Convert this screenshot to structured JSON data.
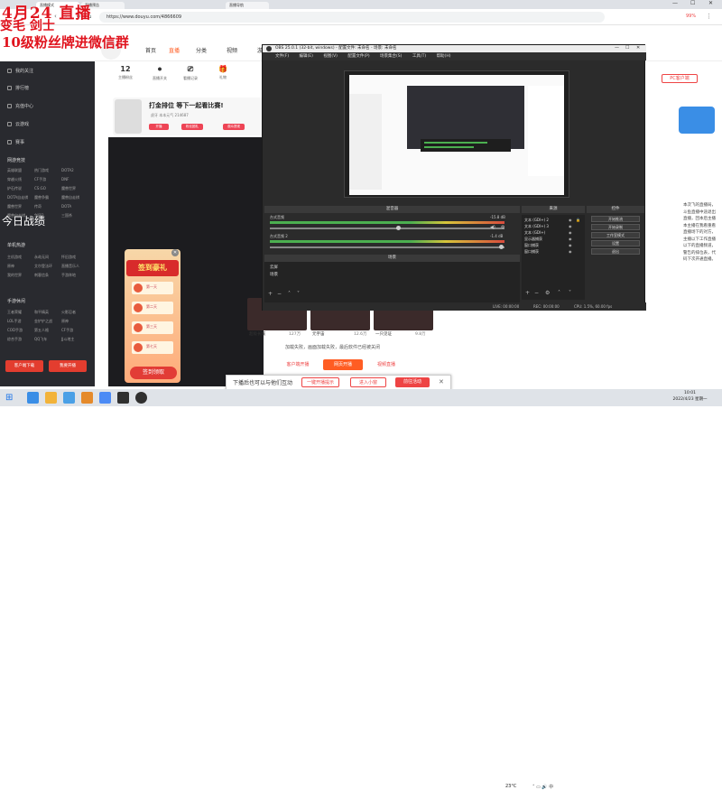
{
  "overlay": {
    "line1": "4月24 直播",
    "line2": "变毛 剑士",
    "line3": "10级粉丝牌进微信群",
    "line4": "今日战绩"
  },
  "browser": {
    "tabs": [
      {
        "label": "直播模式"
      },
      {
        "label": "直播预告"
      },
      {
        "label": "直播导航"
      }
    ],
    "url": "https://www.douyu.com/4866609",
    "profile_pct": "99%"
  },
  "sidebar": {
    "items": [
      {
        "label": "我的关注"
      },
      {
        "label": "排行榜"
      },
      {
        "label": "充值中心"
      },
      {
        "label": "云游戏"
      },
      {
        "label": "赛事"
      }
    ],
    "section1": "网游竞技",
    "grid1": [
      "英雄联盟",
      "热门游戏",
      "DOTA2",
      "穿越火线",
      "CF手游",
      "DNF",
      "炉石传说",
      "CS:GO",
      "魔兽世界",
      "DOTA自走棋",
      "魔兽争霸",
      "魔兽自走棋",
      "魔兽世界",
      "传奇",
      "DOTA",
      "魔兽自走棋",
      "剑网3",
      "三国杀"
    ],
    "section2": "单机热游",
    "grid2": [
      "主机游戏",
      "永劫无间",
      "怀旧游戏",
      "原神",
      "艾尔登法环",
      "直播音乐人",
      "我的世界",
      "刺客信条",
      "手游阵地"
    ],
    "section3": "手游休闲",
    "grid3": [
      "王者荣耀",
      "和平精英",
      "火影忍者",
      "LOL手游",
      "金铲铲之战",
      "原神",
      "COD手游",
      "第五人格",
      "CF手游",
      "综合手游",
      "QQ飞车",
      "JJ斗地主"
    ],
    "btn_client": "客户端下载",
    "btn_live": "我要开播"
  },
  "topnav": {
    "links": [
      "首页",
      "直播",
      "分类",
      "视频",
      "游戏"
    ],
    "stats": [
      {
        "value": "12",
        "label": "主播粉丝"
      },
      {
        "value": "",
        "label": "直播开关"
      },
      {
        "value": "",
        "label": "看播记录"
      },
      {
        "value": "",
        "label": "礼物"
      }
    ]
  },
  "promo": {
    "title": "打金排位 等下一起看比赛!",
    "line": "虎牙 本本元气 214687",
    "tags": [
      "开播",
      "粉丝团礼",
      "观众提现",
      "视频查看"
    ]
  },
  "popup": {
    "title": "签到豪礼",
    "rewards": [
      "第一天",
      "第二天",
      "第三天",
      "第七天"
    ],
    "button": "签到领取"
  },
  "obs": {
    "title": "OBS 25.0.1 (32-bit, windows) - 配置文件: 未命名 - 场景: 未命名",
    "menu": [
      "文件(F)",
      "编辑(E)",
      "视图(V)",
      "配置文件(P)",
      "场景集合(S)",
      "工具(T)",
      "帮助(H)"
    ],
    "mixer_title": "混音器",
    "tracks": [
      {
        "name": "台式音频",
        "db": "-15.8 dB"
      },
      {
        "name": "台式音频 2",
        "db": "-1.4 dB"
      }
    ],
    "scenes_title": "场景",
    "scenes": [
      "云屏",
      "场景"
    ],
    "sources_title": "来源",
    "sources": [
      "文本 (GDI+) 2",
      "文本 (GDI+) 3",
      "文本 (GDI+)",
      "显示器捕获",
      "窗口捕获",
      "窗口捕获"
    ],
    "controls_title": "控件",
    "controls": [
      "开始推流",
      "开始录制",
      "工作室模式",
      "设置",
      "退出"
    ],
    "status": {
      "live": "LIVE: 00:00:00",
      "rec": "REC: 00:00:00",
      "cpu": "CPU: 1.5%, 60.00 fps"
    }
  },
  "content": {
    "thumbs": [
      {
        "caption": "超级长城",
        "count": ""
      },
      {
        "caption": "元宇宙",
        "count": "127万"
      },
      {
        "caption": "云顶城堡",
        "count": "12.6万"
      },
      {
        "caption": "一只见证",
        "count": "9.8万"
      }
    ],
    "loadfail": "加载失败，画面加载失败，最后软件已经被关闭",
    "btn_client_open": "客户端开播",
    "btn_start": "网页开播",
    "btn_stream": "视频直播"
  },
  "banner": {
    "text": "下播后也可以与他们互动",
    "btn1": "一键开播提示",
    "btn2": "进入小窗",
    "btn3": "前往活动"
  },
  "rightpanel": {
    "pc_btn": "PC客户端",
    "text": "本次飞的直播局，斗鱼直播中途退出直播，回本后主播本主播在我看重看直播场下的对方，主播以下工作直播以下的直播频道，警告的排位表，代码下次开通直播。"
  },
  "taskbar": {
    "temp": "23°C",
    "time": "10:01",
    "date": "2022/4/23 星期一"
  },
  "colors": {
    "overlay_red": "#e0141e",
    "douyu_orange": "#ff5d23",
    "obs_bg": "#2b2b2b",
    "sidebar_bg": "#292a2f"
  }
}
